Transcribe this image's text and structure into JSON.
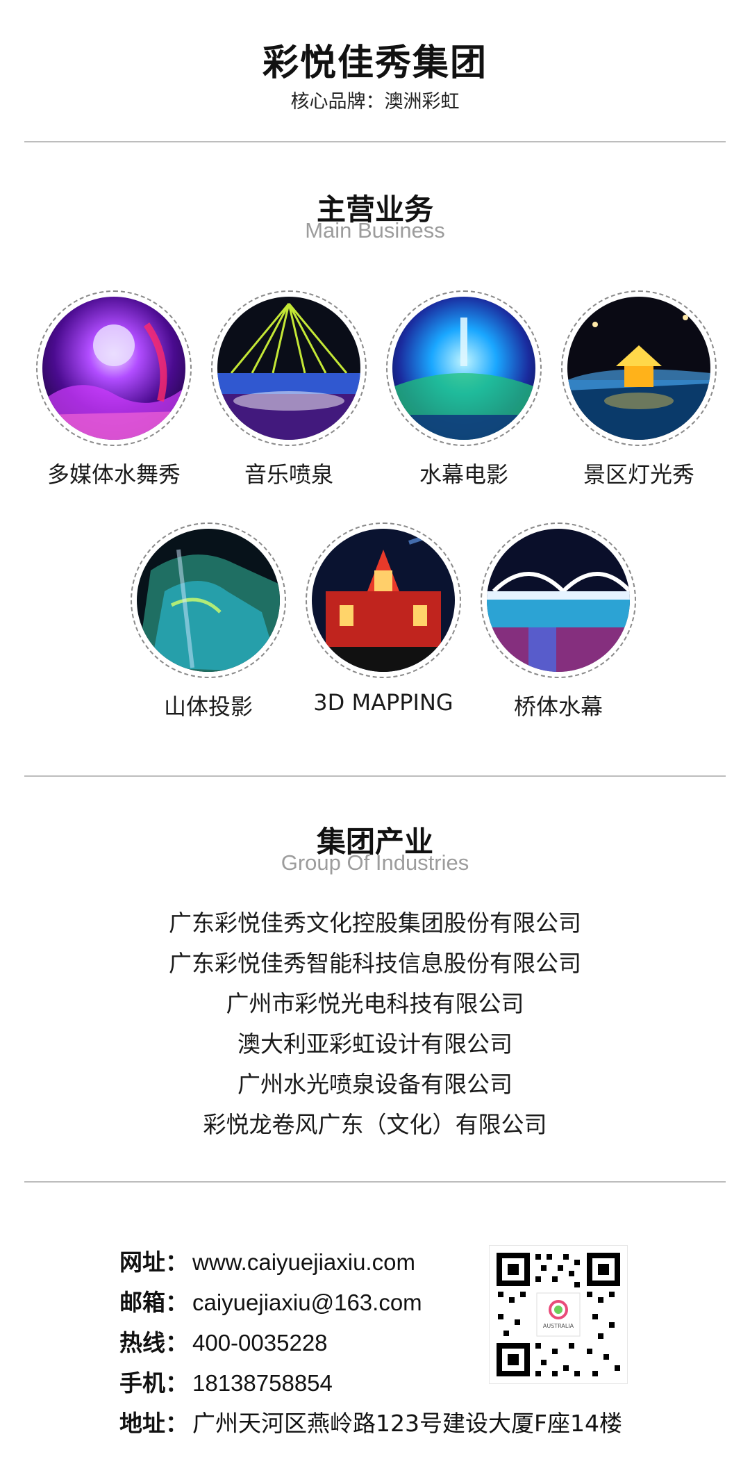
{
  "header": {
    "title": "彩悦佳秀集团",
    "subtitle": "核心品牌：澳洲彩虹"
  },
  "main_business": {
    "title": "主营业务",
    "subtitle": "Main Business",
    "items": [
      {
        "label": "多媒体水舞秀",
        "icon": "multimedia-water-show-photo"
      },
      {
        "label": "音乐喷泉",
        "icon": "music-fountain-photo"
      },
      {
        "label": "水幕电影",
        "icon": "water-screen-movie-photo"
      },
      {
        "label": "景区灯光秀",
        "icon": "scenic-light-show-photo"
      },
      {
        "label": "山体投影",
        "icon": "mountain-projection-photo"
      },
      {
        "label": "3D MAPPING",
        "icon": "3d-mapping-photo"
      },
      {
        "label": "桥体水幕",
        "icon": "bridge-water-screen-photo"
      }
    ]
  },
  "industries": {
    "title": "集团产业",
    "subtitle": "Group Of Industries",
    "items": [
      "广东彩悦佳秀文化控股集团股份有限公司",
      "广东彩悦佳秀智能科技信息股份有限公司",
      "广州市彩悦光电科技有限公司",
      "澳大利亚彩虹设计有限公司",
      "广州水光喷泉设备有限公司",
      "彩悦龙卷风广东（文化）有限公司"
    ]
  },
  "contact": {
    "website_label": "网址：",
    "website": "www.caiyuejiaxiu.com",
    "email_label": "邮箱：",
    "email": "caiyuejiaxiu@163.com",
    "hotline_label": "热线：",
    "hotline": "400-0035228",
    "mobile_label": "手机：",
    "mobile": "18138758854",
    "address_label": "地址：",
    "address": "广州天河区燕岭路123号建设大厦F座14楼"
  },
  "qr": {
    "icon": "qr-code",
    "logo_text": "AUSTRALIA"
  }
}
